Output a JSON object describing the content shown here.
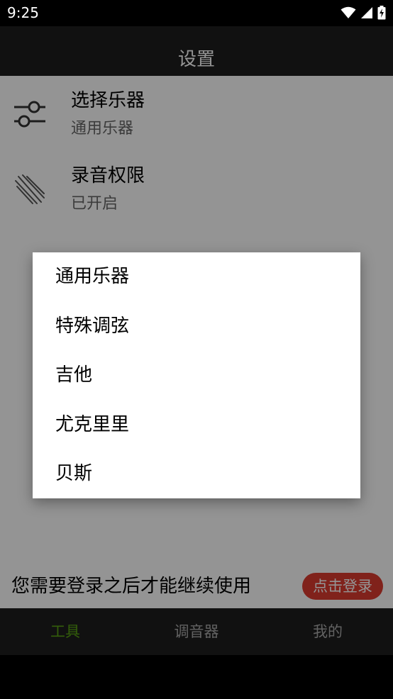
{
  "status_bar": {
    "time": "9:25",
    "icons": [
      "wifi-icon",
      "cell-signal-icon",
      "battery-charging-icon"
    ]
  },
  "app_bar": {
    "title": "设置"
  },
  "settings": [
    {
      "title": "选择乐器",
      "subtitle": "通用乐器",
      "icon": "sliders-icon"
    },
    {
      "title": "录音权限",
      "subtitle": "已开启",
      "icon": "microphone-permission-icon"
    }
  ],
  "instrument_dialog": {
    "options": [
      "通用乐器",
      "特殊调弦",
      "吉他",
      "尤克里里",
      "贝斯"
    ]
  },
  "login_banner": {
    "message": "您需要登录之后才能继续使用",
    "button_label": "点击登录"
  },
  "bottom_nav": {
    "items": [
      {
        "label": "工具",
        "active": true
      },
      {
        "label": "调音器",
        "active": false
      },
      {
        "label": "我的",
        "active": false
      }
    ]
  },
  "colors": {
    "accent_green": "#59a312",
    "login_button_red": "#dd3b30",
    "bar_background": "#1e1e1e"
  }
}
